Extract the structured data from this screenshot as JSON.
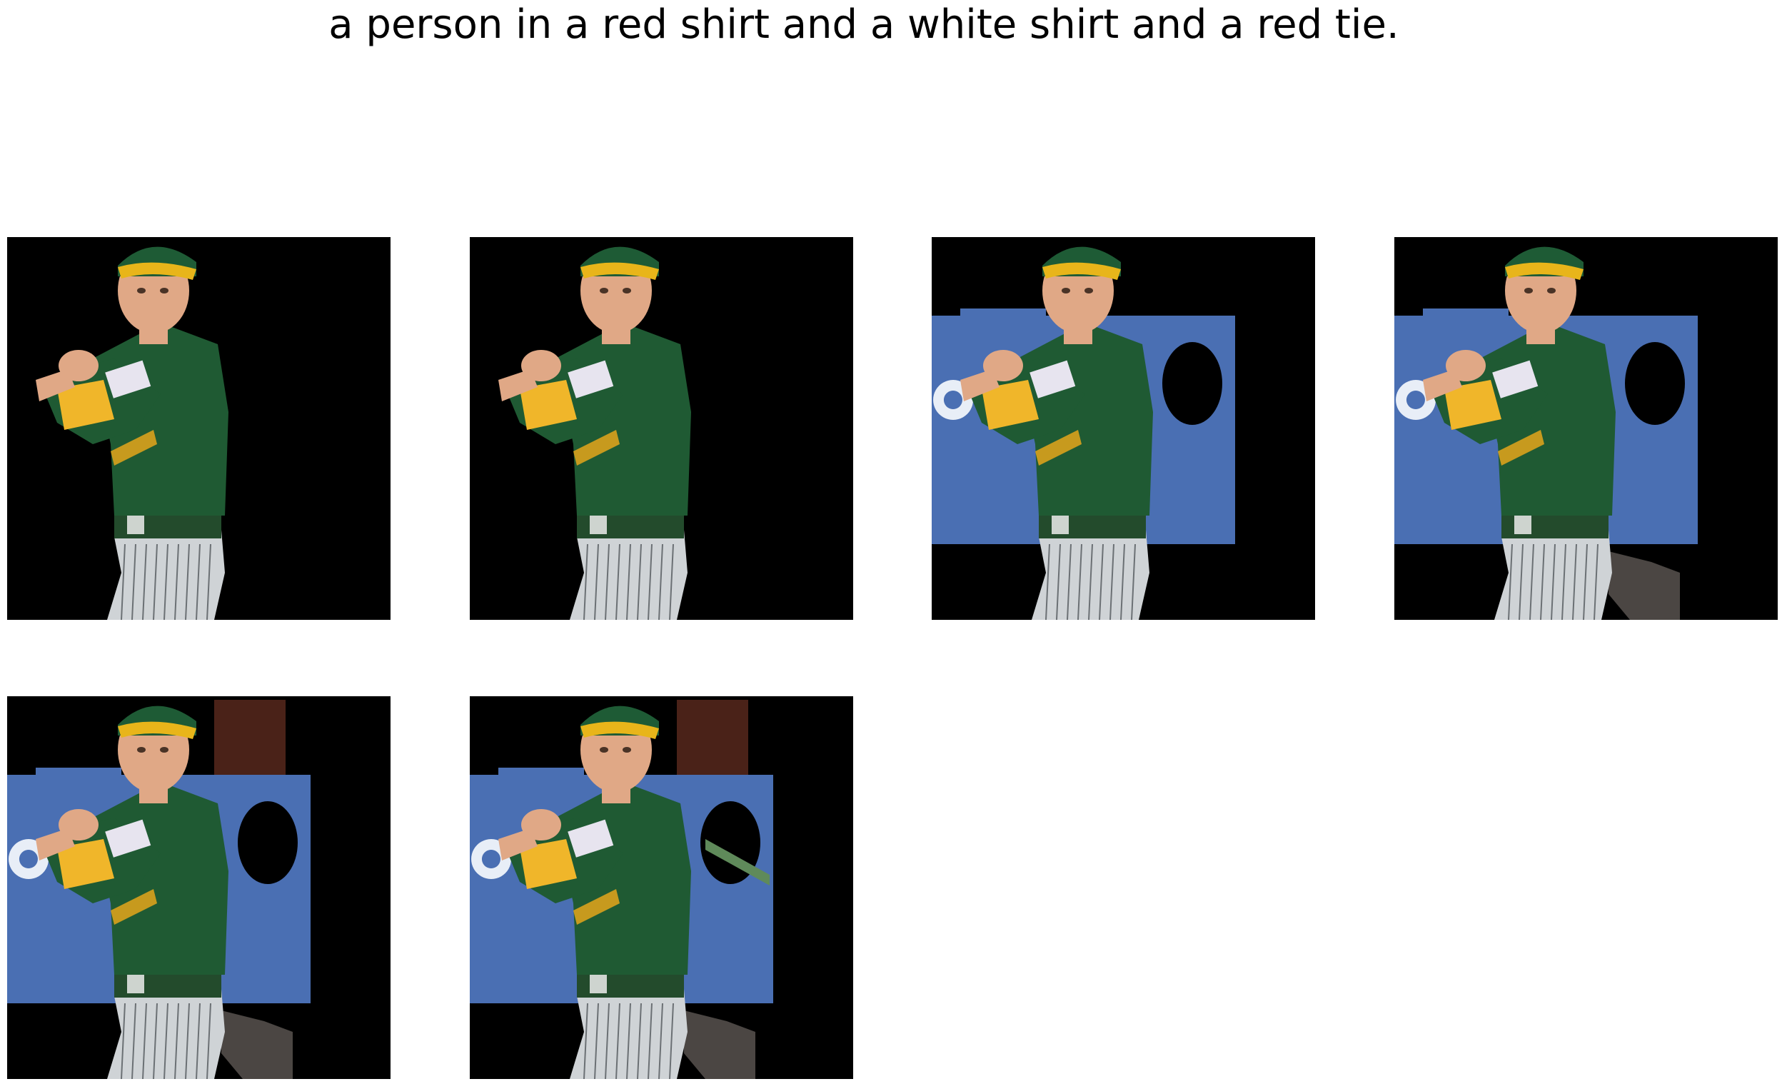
{
  "figure": {
    "caption": "a person in a red shirt and a white shirt and a red tie."
  },
  "colors": {
    "background": "#ffffff",
    "mask": "#000000",
    "jersey": "#1f5a33",
    "cap_brim": "#e8b51a",
    "sleeve": "#f0b62a",
    "pants": "#cfd3d6",
    "banner": "#4a6fb3",
    "skin": "#e0a886"
  },
  "panels": [
    {
      "id": "panel-1",
      "reveals": [
        "person"
      ]
    },
    {
      "id": "panel-2",
      "reveals": [
        "person"
      ]
    },
    {
      "id": "panel-3",
      "reveals": [
        "person",
        "banner"
      ]
    },
    {
      "id": "panel-4",
      "reveals": [
        "person",
        "banner",
        "ground-patch"
      ]
    },
    {
      "id": "panel-5",
      "reveals": [
        "person",
        "banner",
        "ground-patch",
        "dark-red-wall"
      ]
    },
    {
      "id": "panel-6",
      "reveals": [
        "person",
        "banner",
        "ground-patch",
        "dark-red-wall",
        "hole-fill"
      ]
    }
  ]
}
